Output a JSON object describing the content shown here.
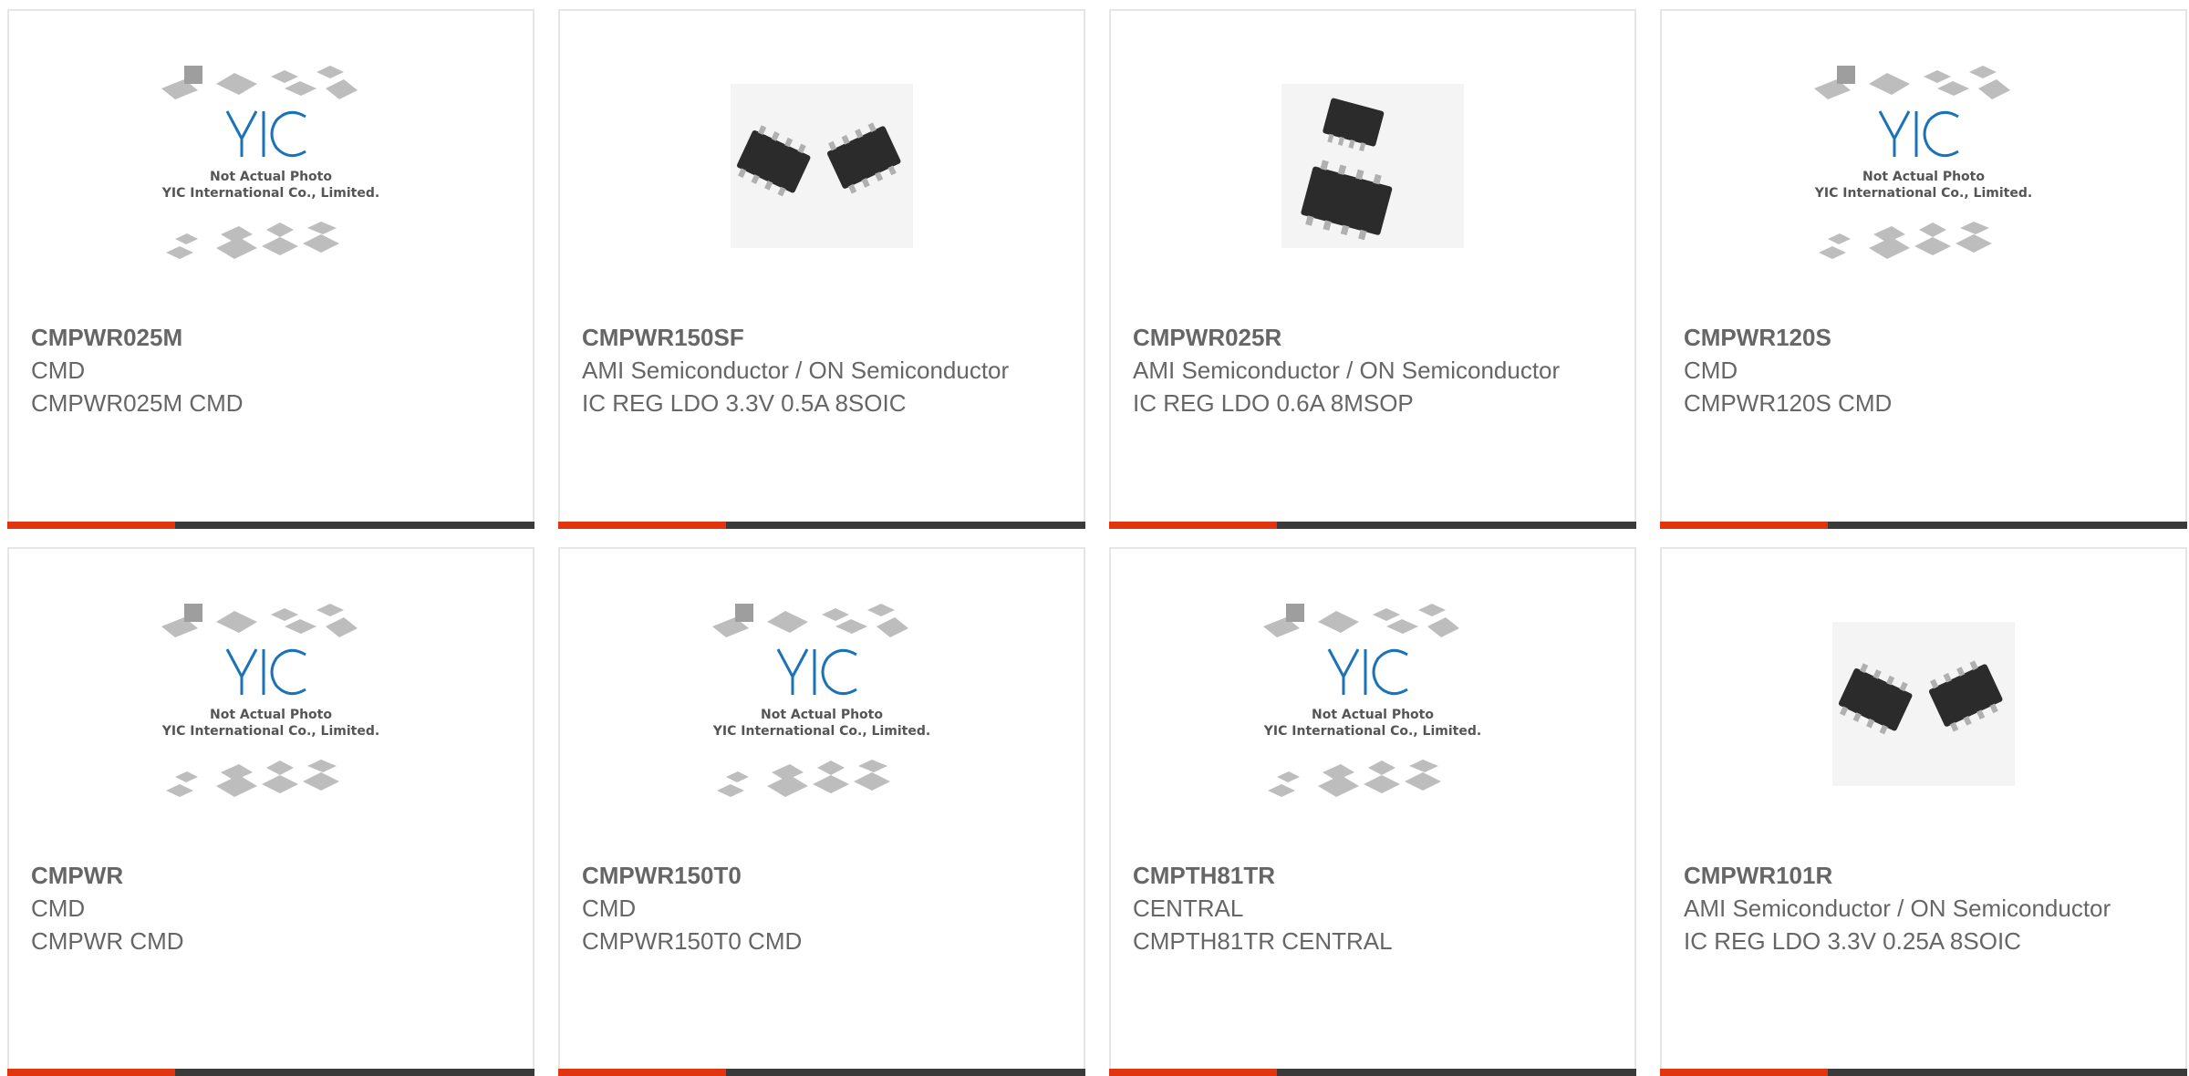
{
  "products": [
    {
      "part": "CMPWR025M",
      "maker": "CMD",
      "desc": "CMPWR025M CMD",
      "image": "yic-placeholder",
      "placeholder_line1": "Not Actual Photo",
      "placeholder_line2": "YIC International Co., Limited."
    },
    {
      "part": "CMPWR150SF",
      "maker": "AMI Semiconductor / ON Semiconductor",
      "desc": "IC REG LDO 3.3V 0.5A 8SOIC",
      "image": "soic-8-chip-photo"
    },
    {
      "part": "CMPWR025R",
      "maker": "AMI Semiconductor / ON Semiconductor",
      "desc": "IC REG LDO 0.6A 8MSOP",
      "image": "msop-8-chip-photo"
    },
    {
      "part": "CMPWR120S",
      "maker": "CMD",
      "desc": "CMPWR120S CMD",
      "image": "yic-placeholder",
      "placeholder_line1": "Not Actual Photo",
      "placeholder_line2": "YIC International Co., Limited."
    },
    {
      "part": "CMPWR",
      "maker": "CMD",
      "desc": "CMPWR CMD",
      "image": "yic-placeholder",
      "placeholder_line1": "Not Actual Photo",
      "placeholder_line2": "YIC International Co., Limited."
    },
    {
      "part": "CMPWR150T0",
      "maker": "CMD",
      "desc": "CMPWR150T0 CMD",
      "image": "yic-placeholder",
      "placeholder_line1": "Not Actual Photo",
      "placeholder_line2": "YIC International Co., Limited."
    },
    {
      "part": "CMPTH81TR",
      "maker": "CENTRAL",
      "desc": "CMPTH81TR CENTRAL",
      "image": "yic-placeholder",
      "placeholder_line1": "Not Actual Photo",
      "placeholder_line2": "YIC International Co., Limited."
    },
    {
      "part": "CMPWR101R",
      "maker": "AMI Semiconductor / ON Semiconductor",
      "desc": "IC REG LDO 3.3V 0.25A 8SOIC",
      "image": "soic-8-chip-photo"
    }
  ],
  "colors": {
    "accent": "#e0350f",
    "bar": "#3a3a3a",
    "text": "#666666",
    "yic_blue": "#1a73b8"
  }
}
